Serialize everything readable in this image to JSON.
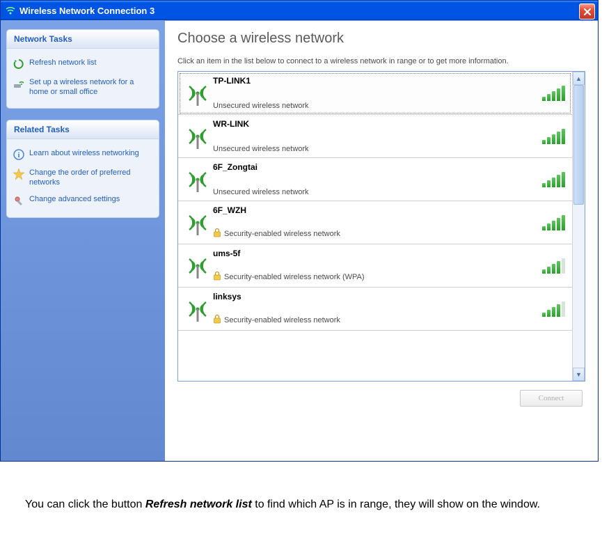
{
  "titlebar": {
    "title": "Wireless Network Connection 3"
  },
  "sidebar": {
    "panel1": {
      "header": "Network Tasks",
      "items": [
        {
          "label": "Refresh network list",
          "icon": "refresh-icon"
        },
        {
          "label": "Set up a wireless network for a home or small office",
          "icon": "setup-network-icon"
        }
      ]
    },
    "panel2": {
      "header": "Related Tasks",
      "items": [
        {
          "label": "Learn about wireless networking",
          "icon": "info-icon"
        },
        {
          "label": "Change the order of preferred networks",
          "icon": "star-icon"
        },
        {
          "label": "Change advanced settings",
          "icon": "settings-icon"
        }
      ]
    }
  },
  "main": {
    "title": "Choose a wireless network",
    "subtitle": "Click an item in the list below to connect to a wireless network in range or to get more information.",
    "connect_label": "Connect"
  },
  "networks": [
    {
      "name": "TP-LINK1",
      "security": "Unsecured wireless network",
      "secured": false,
      "signal": 5,
      "selected": true
    },
    {
      "name": "WR-LINK",
      "security": "Unsecured wireless network",
      "secured": false,
      "signal": 5,
      "selected": false
    },
    {
      "name": "6F_Zongtai",
      "security": "Unsecured wireless network",
      "secured": false,
      "signal": 5,
      "selected": false
    },
    {
      "name": "6F_WZH",
      "security": "Security-enabled wireless network",
      "secured": true,
      "signal": 5,
      "selected": false
    },
    {
      "name": "ums-5f",
      "security": "Security-enabled wireless network (WPA)",
      "secured": true,
      "signal": 4,
      "selected": false
    },
    {
      "name": "linksys",
      "security": "Security-enabled wireless network",
      "secured": true,
      "signal": 4,
      "selected": false
    }
  ],
  "instruction": {
    "pre": "You can click the button ",
    "bold": "Refresh network list",
    "post": "  to find which AP is in range, they will show on the window."
  }
}
